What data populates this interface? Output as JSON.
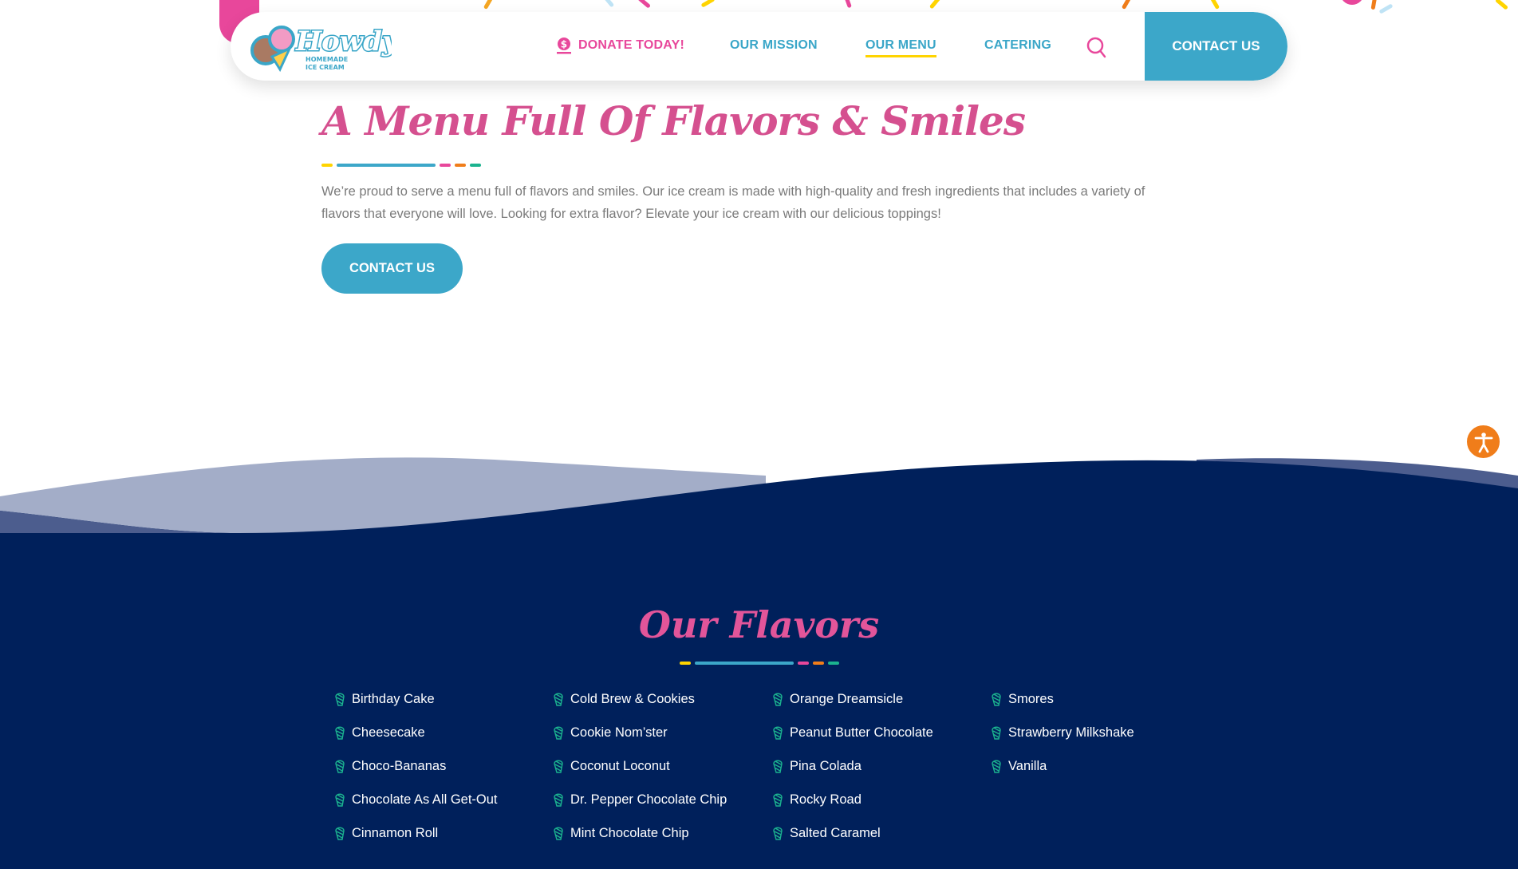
{
  "colors": {
    "pink": "#d5508f",
    "blue": "#3ca7c9",
    "navy": "#00205b",
    "yellow": "#ffd400",
    "orange": "#f07d1a",
    "green": "#1bb38f"
  },
  "nav": {
    "logo_text": "Howdy Homemade Ice Cream",
    "donate": "DONATE TODAY!",
    "mission": "OUR MISSION",
    "menu": "OUR MENU",
    "catering": "CATERING",
    "search_icon": "search-icon",
    "contact": "CONTACT US"
  },
  "hero": {
    "title": "A Menu Full Of Flavors & Smiles",
    "text": "We’re proud to serve a menu full of flavors and smiles. Our ice cream is made with high-quality and fresh ingredients that includes a variety of flavors that everyone will love. Looking for extra flavor? Elevate your ice cream with our delicious toppings!",
    "button": "CONTACT US"
  },
  "flavors": {
    "title": "Our Flavors",
    "items": [
      "Birthday Cake",
      "Cheesecake",
      "Choco-Bananas",
      "Chocolate As All Get-Out",
      "Cinnamon Roll",
      "Cold Brew & Cookies",
      "Cookie Nom’ster",
      "Coconut Loconut",
      "Dr. Pepper Chocolate Chip",
      "Mint Chocolate Chip",
      "Orange Dreamsicle",
      "Peanut Butter Chocolate",
      "Pina Colada",
      "Rocky Road",
      "Salted Caramel",
      "Smores",
      "Strawberry Milkshake",
      "Vanilla"
    ]
  },
  "accessibility_icon": "accessibility-icon"
}
